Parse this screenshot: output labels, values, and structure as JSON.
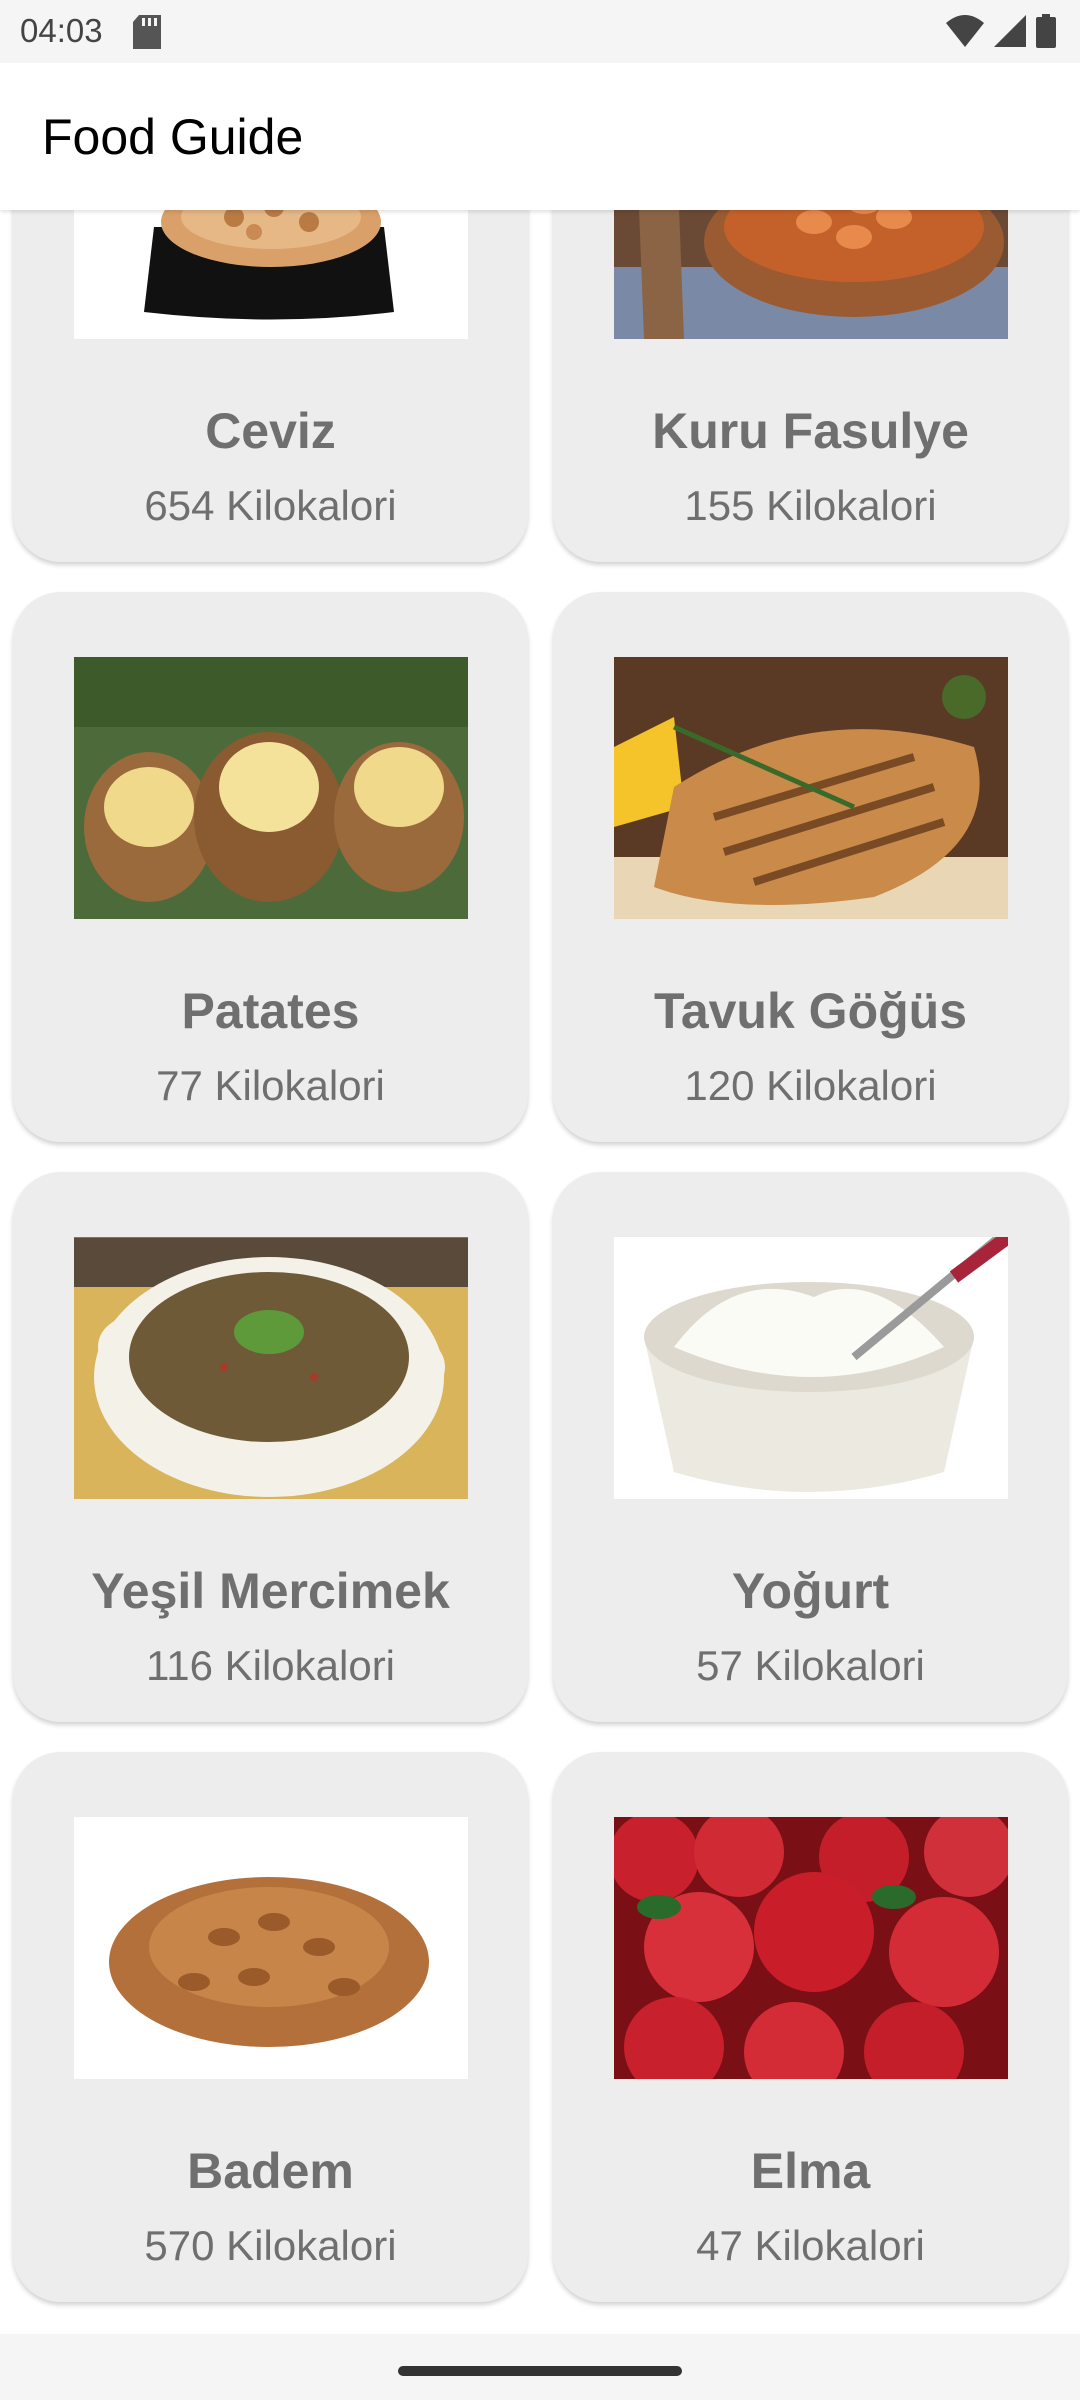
{
  "status_bar": {
    "time": "04:03",
    "icons": [
      "sd-card-icon",
      "wifi-icon",
      "signal-icon",
      "battery-icon"
    ]
  },
  "app_bar": {
    "title": "Food Guide"
  },
  "foods": [
    {
      "name": "Ceviz",
      "calories": "654 Kilokalori",
      "image": "walnut-image"
    },
    {
      "name": "Kuru Fasulye",
      "calories": "155 Kilokalori",
      "image": "beans-image"
    },
    {
      "name": "Patates",
      "calories": "77 Kilokalori",
      "image": "potato-image"
    },
    {
      "name": "Tavuk Göğüs",
      "calories": "120 Kilokalori",
      "image": "chicken-image"
    },
    {
      "name": "Yeşil Mercimek",
      "calories": "116 Kilokalori",
      "image": "lentil-image"
    },
    {
      "name": "Yoğurt",
      "calories": "57 Kilokalori",
      "image": "yogurt-image"
    },
    {
      "name": "Badem",
      "calories": "570 Kilokalori",
      "image": "almond-image"
    },
    {
      "name": "Elma",
      "calories": "47 Kilokalori",
      "image": "apple-image"
    }
  ]
}
